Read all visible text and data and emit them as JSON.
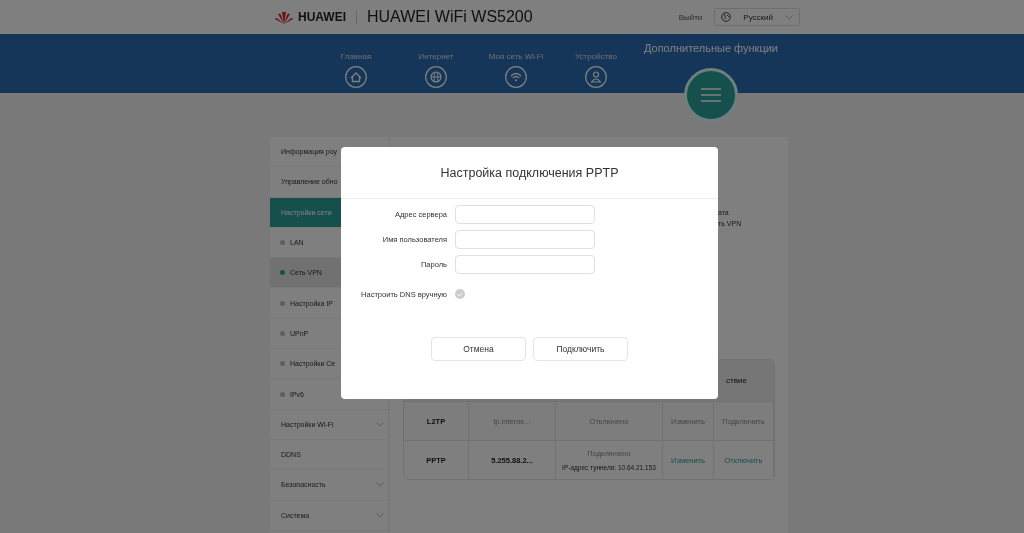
{
  "header": {
    "brand": "HUAWEI",
    "title": "HUAWEI WiFi WS5200",
    "logout": "Выйти",
    "language": "Русский"
  },
  "nav": {
    "items": [
      {
        "label": "Главная"
      },
      {
        "label": "Интернет"
      },
      {
        "label": "Моя сеть Wi-Fi"
      },
      {
        "label": "Устройство"
      }
    ],
    "more": {
      "label": "Дополнительные функции"
    }
  },
  "sidebar": {
    "items": [
      {
        "label": "Информация роу",
        "kind": "link",
        "selected": false
      },
      {
        "label": "Управление обно",
        "kind": "link",
        "selected": false
      },
      {
        "label": "Настройки сети",
        "kind": "section",
        "selected": true
      },
      {
        "label": "LAN",
        "kind": "sub",
        "selected": false
      },
      {
        "label": "Сеть VPN",
        "kind": "sub",
        "selected": true
      },
      {
        "label": "Настройка IP",
        "kind": "sub",
        "selected": false
      },
      {
        "label": "UPnP",
        "kind": "sub",
        "selected": false
      },
      {
        "label": "Настройки Се",
        "kind": "sub",
        "selected": false
      },
      {
        "label": "IPv6",
        "kind": "sub",
        "selected": false
      },
      {
        "label": "Настройки Wi-Fi",
        "kind": "group",
        "selected": false
      },
      {
        "label": "DDNS",
        "kind": "link",
        "selected": false
      },
      {
        "label": "Безопасность",
        "kind": "group",
        "selected": false
      },
      {
        "label": "Система",
        "kind": "group",
        "selected": false
      }
    ]
  },
  "content": {
    "fragments": [
      "ата",
      "ть VPN"
    ],
    "table": {
      "column_5": "ствие",
      "rows": [
        {
          "protocol": "L2TP",
          "server": "tp.interne...",
          "status": "Отключено",
          "edit": "Изменить",
          "action": "Подключить",
          "active": false
        },
        {
          "protocol": "PPTP",
          "server": "5.255.88.2...",
          "status": "Подключено",
          "detail": "IP-адрес туннеля: 10.64.21.153",
          "edit": "Изменить",
          "action": "Отключить",
          "active": true
        }
      ]
    }
  },
  "dialog": {
    "title": "Настройка подключения PPTP",
    "fields": [
      {
        "label": "Адрес сервера"
      },
      {
        "label": "Имя пользователя"
      },
      {
        "label": "Пароль"
      }
    ],
    "dns": {
      "label": "Настроить DNS вручную",
      "checked": false
    },
    "buttons": [
      "Отмена",
      "Подключить"
    ]
  }
}
